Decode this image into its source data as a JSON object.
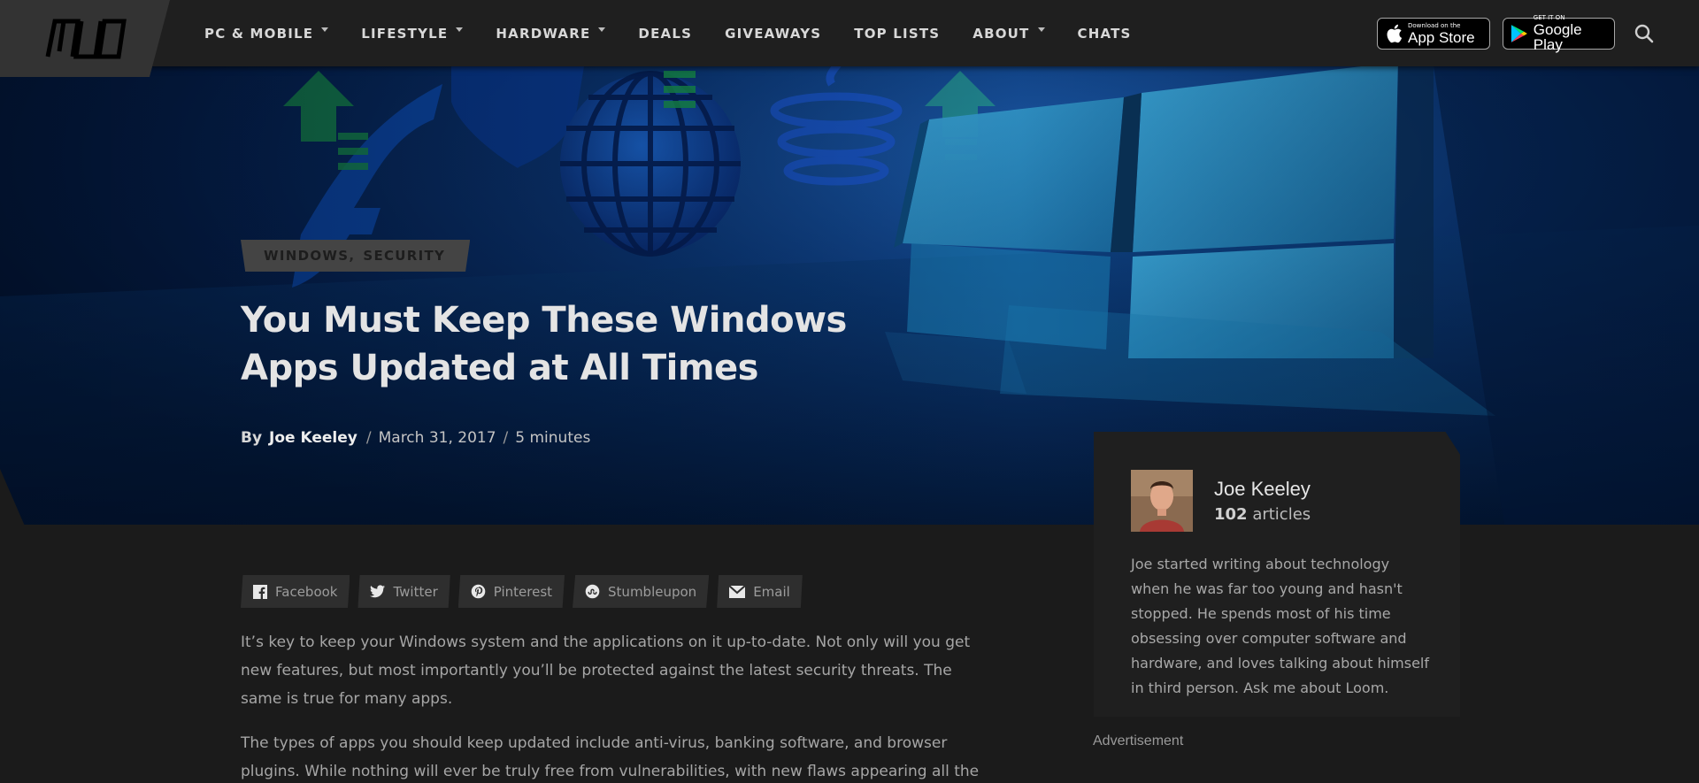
{
  "nav": {
    "logo_text": "MUO",
    "items": [
      {
        "label": "PC & MOBILE",
        "dropdown": true
      },
      {
        "label": "LIFESTYLE",
        "dropdown": true
      },
      {
        "label": "HARDWARE",
        "dropdown": true
      },
      {
        "label": "DEALS",
        "dropdown": false
      },
      {
        "label": "GIVEAWAYS",
        "dropdown": false
      },
      {
        "label": "TOP LISTS",
        "dropdown": false
      },
      {
        "label": "ABOUT",
        "dropdown": true
      },
      {
        "label": "CHATS",
        "dropdown": false
      }
    ],
    "app_store": {
      "small": "Download on the",
      "big": "App Store"
    },
    "google_play": {
      "small": "GET IT ON",
      "big": "Google Play"
    },
    "search_icon": "search-icon"
  },
  "article": {
    "tags": [
      "WINDOWS",
      "SECURITY"
    ],
    "tag_separator": ",",
    "title": "You Must Keep These Windows Apps Updated at All Times",
    "by": "By",
    "author": "Joe Keeley",
    "slash": "/",
    "date": "March 31, 2017",
    "read_time": "5 minutes"
  },
  "share": {
    "buttons": [
      {
        "label": "Facebook",
        "icon": "facebook-icon"
      },
      {
        "label": "Twitter",
        "icon": "twitter-icon"
      },
      {
        "label": "Pinterest",
        "icon": "pinterest-icon"
      },
      {
        "label": "Stumbleupon",
        "icon": "stumbleupon-icon"
      },
      {
        "label": "Email",
        "icon": "email-icon"
      }
    ]
  },
  "body": {
    "p1": "It’s key to keep your Windows system and the applications on it up-to-date. Not only will you get new features, but most importantly you’ll be protected against the latest security threats. The same is true for many apps.",
    "p2": "The types of apps you should keep updated include anti-virus, banking software, and browser plugins. While nothing will ever be truly free from vulnerabilities, with new flaws appearing all the"
  },
  "author_card": {
    "name": "Joe Keeley",
    "article_count": "102",
    "articles_label": "articles",
    "bio": "Joe started writing about technology when he was far too young and hasn't stopped. He spends most of his time obsessing over computer software and hardware, and loves talking about himself in third person. Ask me about Loom."
  },
  "sidebar": {
    "advertisement_label": "Advertisement"
  },
  "colors": {
    "nav_bg": "#1f1f1f",
    "page_bg": "#1b1b1b",
    "hero_blue": "#0c3a7a",
    "tag_bg": "#444444"
  }
}
